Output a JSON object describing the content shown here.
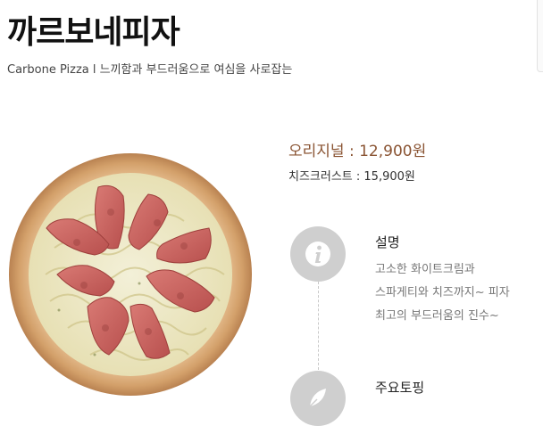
{
  "product": {
    "title": "까르보네피자",
    "subtitle": "Carbone Pizza l 느끼함과 부드러움으로 여심을 사로잡는"
  },
  "prices": {
    "original": "오리지널 : 12,900원",
    "cheese_crust": "치즈크러스트 : 15,900원"
  },
  "description": {
    "heading": "설명",
    "lines": [
      "고소한 화이트크림과",
      "스파게티와 치즈까지~ 피자",
      "최고의 부드러움의 진수~"
    ]
  },
  "toppings": {
    "heading": "주요토핑"
  },
  "icons": {
    "description": "info-icon",
    "toppings": "leaf-icon",
    "image": "pizza-image"
  },
  "colors": {
    "price_accent": "#8a5433",
    "icon_circle": "#cfcfcf",
    "description_text": "#777777"
  }
}
